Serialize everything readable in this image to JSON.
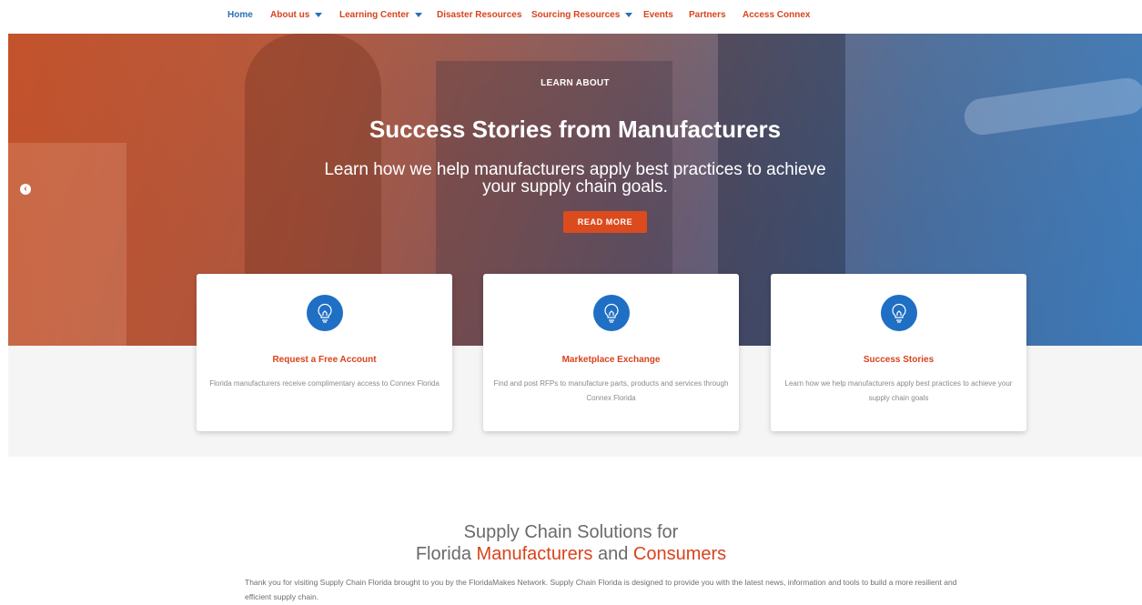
{
  "nav": {
    "items": [
      {
        "label": "Home",
        "active": true,
        "dropdown": false
      },
      {
        "label": "About us",
        "active": false,
        "dropdown": true
      },
      {
        "label": "Learning Center",
        "active": false,
        "dropdown": true
      },
      {
        "label": "Disaster Resources",
        "active": false,
        "dropdown": false
      },
      {
        "label": "Sourcing Resources",
        "active": false,
        "dropdown": true
      },
      {
        "label": "Events",
        "active": false,
        "dropdown": false
      },
      {
        "label": "Partners",
        "active": false,
        "dropdown": false
      },
      {
        "label": "Access Connex",
        "active": false,
        "dropdown": false
      }
    ]
  },
  "hero": {
    "eyebrow": "LEARN ABOUT",
    "title": "Success Stories from Manufacturers",
    "subtitle": "Learn how we help manufacturers apply best practices to achieve your supply chain goals.",
    "button": "READ MORE",
    "prev_icon": "chevron-left-icon"
  },
  "cards": [
    {
      "icon": "lightbulb-icon",
      "title": "Request a Free Account",
      "text": "Florida manufacturers receive complimentary access to Connex Florida"
    },
    {
      "icon": "lightbulb-icon",
      "title": "Marketplace Exchange",
      "text": "Find and post RFPs to manufacture parts, products and services through Connex Florida"
    },
    {
      "icon": "lightbulb-icon",
      "title": "Success Stories",
      "text": "Learn how we help manufacturers apply best practices to achieve your supply chain goals"
    }
  ],
  "solutions": {
    "line1": "Supply Chain Solutions for",
    "line2_a": "Florida ",
    "line2_b": "Manufacturers",
    "line2_c": " and ",
    "line2_d": "Consumers",
    "body": "Thank you for visiting Supply Chain Florida brought to you by the FloridaMakes Network. Supply Chain Florida is designed to provide you with the latest news, information and tools to build a more resilient and efficient supply chain."
  },
  "colors": {
    "accent": "#d8431c",
    "link": "#2a6fb6",
    "icon_bg": "#1f6fc4"
  }
}
